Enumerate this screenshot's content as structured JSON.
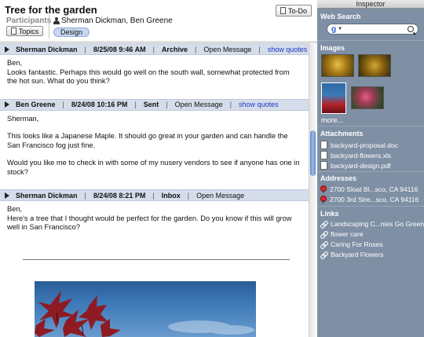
{
  "title": "Tree for the garden",
  "todo_label": "To-Do",
  "participants_label": "Participants",
  "participants": "Sherman Dickman, Ben Greene",
  "topics_label": "Topics",
  "tag": "Design",
  "messages": [
    {
      "sender": "Sherman Dickman",
      "date": "8/25/08 9:46 AM",
      "folder": "Archive",
      "open": "Open Message",
      "quotes": "show quotes",
      "paragraphs": [
        "Ben,\nLooks fantastic.  Perhaps this would go well on the south wall, somewhat protected from the hot sun.  What do you think?"
      ]
    },
    {
      "sender": "Ben Greene",
      "date": "8/24/08 10:16 PM",
      "folder": "Sent",
      "open": "Open Message",
      "quotes": "show quotes",
      "paragraphs": [
        "Sherman,",
        "This looks like a Japanese Maple. It should go great in your garden and can handle the San Francisco fog just fine.",
        "Would you like me to check in with some of my nusery vendors to see if anyone has one in stock?"
      ]
    },
    {
      "sender": "Sherman Dickman",
      "date": "8/24/08 8:21 PM",
      "folder": "Inbox",
      "open": "Open Message",
      "paragraphs": [
        "Ben,\nHere's a tree that I thought would be perfect for the garden.  Do you know if this will grow well in San Francisco?"
      ]
    }
  ],
  "inspector": {
    "title": "Inspector",
    "web_search_label": "Web Search",
    "search_engine": "g",
    "images_label": "Images",
    "more": "more...",
    "attachments_label": "Attachments",
    "attachments": [
      "backyard-proposal.doc",
      "backyard-flowers.xls",
      "backyard-design.pdf"
    ],
    "addresses_label": "Addresses",
    "addresses": [
      "2700 Sloat Bl...sco, CA 94116",
      "2700 3rd Stre...sco, CA 94116"
    ],
    "links_label": "Links",
    "links": [
      "Landscaping C...nies Go Green",
      "flower care",
      "Caring For Roses",
      "Backyard Flowers"
    ]
  }
}
